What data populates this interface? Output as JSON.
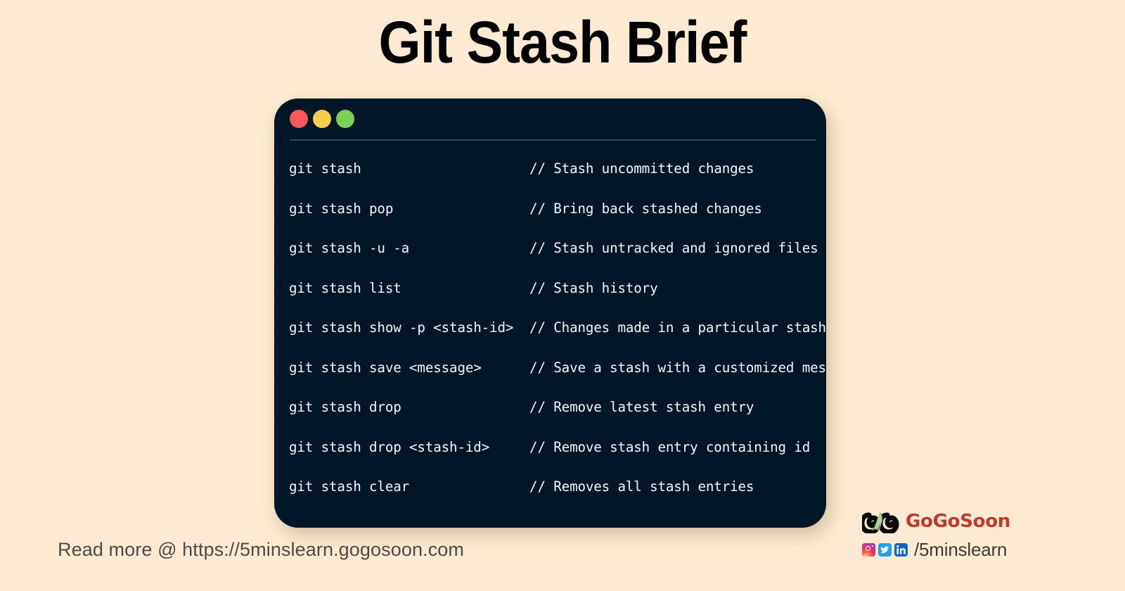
{
  "page": {
    "title": "Git Stash Brief",
    "background_color": "#FCEBD2"
  },
  "terminal": {
    "background_color": "#011627",
    "dots": [
      {
        "name": "close",
        "color": "#F8585A"
      },
      {
        "name": "minimize",
        "color": "#F7CE4B"
      },
      {
        "name": "maximize",
        "color": "#7BD155"
      }
    ],
    "lines": [
      {
        "command": "git stash",
        "comment": "// Stash uncommitted changes"
      },
      {
        "command": "git stash pop",
        "comment": "// Bring back stashed changes"
      },
      {
        "command": "git stash -u -a",
        "comment": "// Stash untracked and ignored files"
      },
      {
        "command": "git stash list",
        "comment": "// Stash history"
      },
      {
        "command": "git stash show -p <stash-id>",
        "comment": "// Changes made in a particular stash"
      },
      {
        "command": "git stash save <message>",
        "comment": "// Save a stash with a customized message"
      },
      {
        "command": "git stash drop",
        "comment": "// Remove latest stash entry"
      },
      {
        "command": "git stash drop <stash-id>",
        "comment": "// Remove stash entry containing id"
      },
      {
        "command": "git stash clear",
        "comment": "// Removes all stash entries"
      }
    ],
    "comment_column": 30
  },
  "footer": {
    "read_more": "Read more @ https://5minslearn.gogosoon.com"
  },
  "brand": {
    "name": "GoGoSoon",
    "name_color": "#C0392B",
    "handle": "/5minslearn",
    "social": [
      {
        "name": "instagram-icon",
        "glyph": "◎"
      },
      {
        "name": "twitter-icon",
        "glyph": "ᵗ"
      },
      {
        "name": "linkedin-icon",
        "glyph": "in"
      }
    ]
  }
}
